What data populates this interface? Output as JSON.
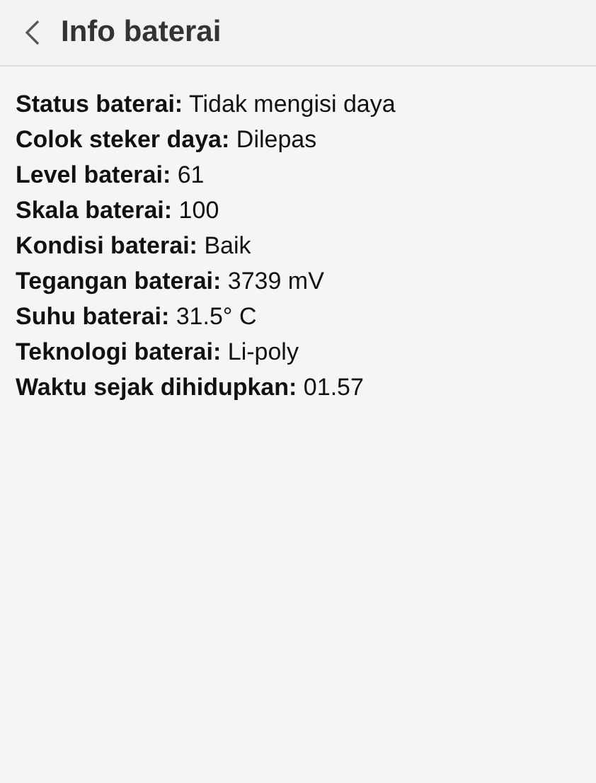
{
  "header": {
    "title": "Info baterai"
  },
  "info_rows": [
    "**Status baterai:** Tidak mengisi daya",
    "**Colok steker daya:** Dilepas",
    "**Level baterai:** 61",
    "**Skala baterai:** 100",
    "**Kondisi baterai:** Baik",
    "**Tegangan baterai:** 3739 mV",
    "**Suhu baterai:** 31.5° C",
    "**Teknologi baterai:** Li-poly",
    "**Waktu sejak dihidupkan:** 01.57"
  ]
}
